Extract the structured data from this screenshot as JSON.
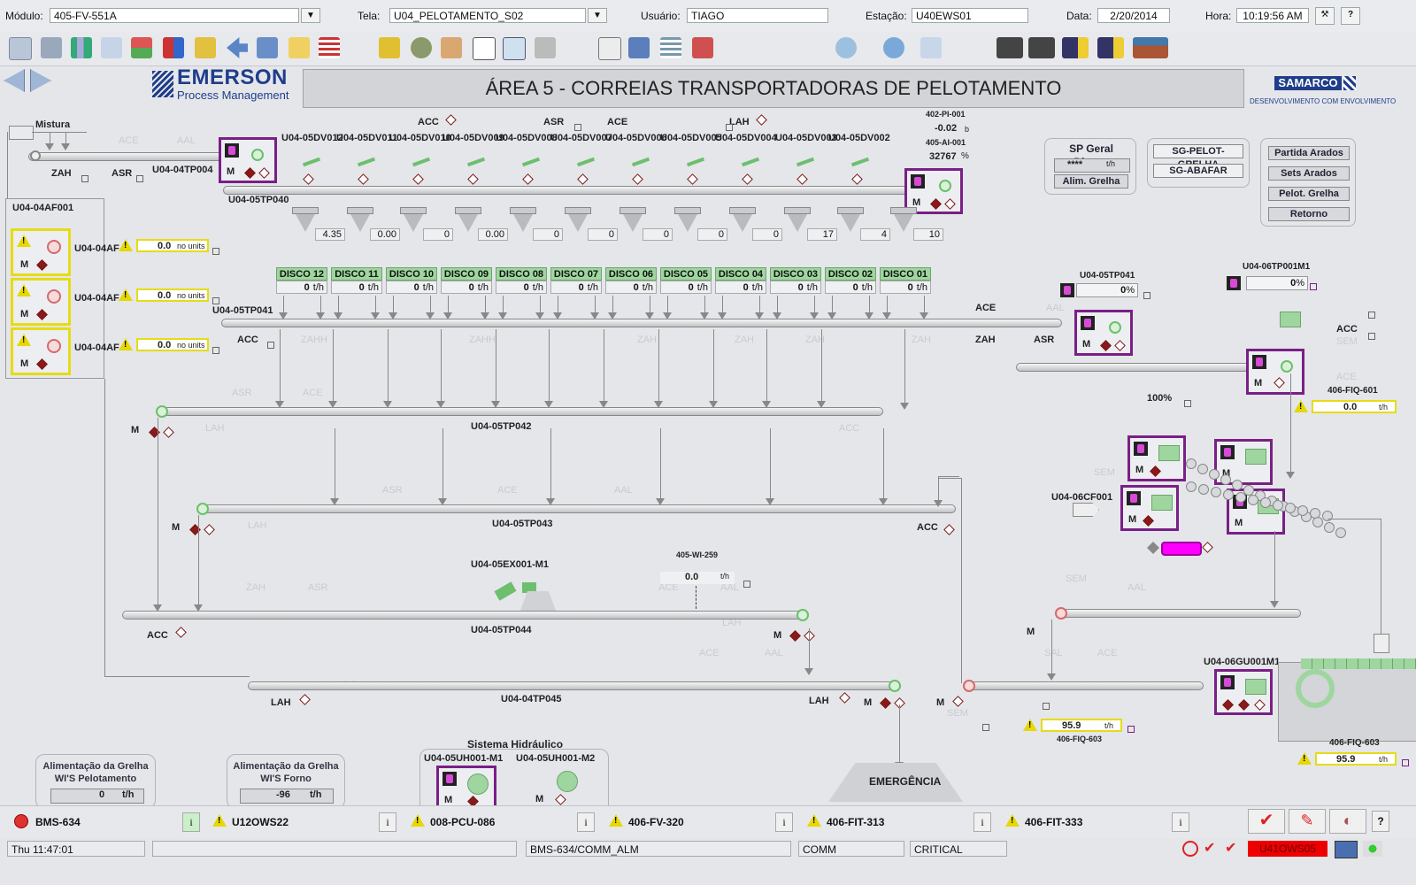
{
  "header": {
    "modulo_label": "Módulo:",
    "modulo_value": "405-FV-551A",
    "tela_label": "Tela:",
    "tela_value": "U04_PELOTAMENTO_S02",
    "usuario_label": "Usuário:",
    "usuario_value": "TIAGO",
    "estacao_label": "Estação:",
    "estacao_value": "U40EWS01",
    "data_label": "Data:",
    "data_value": "2/20/2014",
    "hora_label": "Hora:",
    "hora_value": "10:19:56 AM",
    "help_label": "?"
  },
  "brand": {
    "emerson": "EMERSON",
    "emerson_sub": "Process Management",
    "samarco": "SAMARCO",
    "samarco_sub": "DESENVOLVIMENTO COM ENVOLVIMENTO"
  },
  "title": "ÁREA 5 - CORREIAS TRANSPORTADORAS DE PELOTAMENTO",
  "top": {
    "mistura": "Mistura",
    "zah": "ZAH",
    "asr": "ASR",
    "tp004": "U04-04TP004",
    "acc": "ACC",
    "asr2": "ASR",
    "ace": "ACE",
    "lah": "LAH",
    "pi001_tag": "402-PI-001",
    "pi001_val": "-0.02",
    "pi001_unit": "b",
    "ai001_tag": "405-AI-001",
    "ai001_val": "32767",
    "ai001_unit": "%",
    "tp040": "U04-05TP040",
    "dv_tags": [
      "U04-05DV012",
      "U04-05DV011",
      "U04-05DV010",
      "U04-05DV009",
      "U04-05DV008",
      "U04-05DV007",
      "U04-05DV006",
      "U04-05DV005",
      "U04-05DV004",
      "U04-05DV003",
      "U04-05DV002"
    ]
  },
  "hoppers": [
    "4.35",
    "0.00",
    "0",
    "0.00",
    "0",
    "0",
    "0",
    "0",
    "0",
    "17",
    "4",
    "10"
  ],
  "discos": [
    {
      "name": "DISCO 12",
      "val": "0",
      "unit": "t/h"
    },
    {
      "name": "DISCO 11",
      "val": "0",
      "unit": "t/h"
    },
    {
      "name": "DISCO 10",
      "val": "0",
      "unit": "t/h"
    },
    {
      "name": "DISCO 09",
      "val": "0",
      "unit": "t/h"
    },
    {
      "name": "DISCO 08",
      "val": "0",
      "unit": "t/h"
    },
    {
      "name": "DISCO 07",
      "val": "0",
      "unit": "t/h"
    },
    {
      "name": "DISCO 06",
      "val": "0",
      "unit": "t/h"
    },
    {
      "name": "DISCO 05",
      "val": "0",
      "unit": "t/h"
    },
    {
      "name": "DISCO 04",
      "val": "0",
      "unit": "t/h"
    },
    {
      "name": "DISCO 03",
      "val": "0",
      "unit": "t/h"
    },
    {
      "name": "DISCO 02",
      "val": "0",
      "unit": "t/h"
    },
    {
      "name": "DISCO 01",
      "val": "0",
      "unit": "t/h"
    }
  ],
  "left": {
    "af001": "U04-04AF001",
    "af_short": "U04-04AF",
    "feeders": [
      {
        "val": "0.0",
        "unit": "no units"
      },
      {
        "val": "0.0",
        "unit": "no units"
      },
      {
        "val": "0.0",
        "unit": "no units"
      }
    ]
  },
  "belts": {
    "tp041": "U04-05TP041",
    "tp042": "U04-05TP042",
    "tp043": "U04-05TP043",
    "tp044": "U04-05TP044",
    "tp045": "U04-04TP045",
    "ex001": "U04-05EX001-M1",
    "wi259_tag": "405-WI-259",
    "wi259_val": "0.0",
    "wi259_unit": "t/h",
    "acc": "ACC",
    "lah": "LAH",
    "m": "M",
    "ace": "ACE",
    "zah": "ZAH",
    "asr": "ASR"
  },
  "right": {
    "sp_title": "SP Geral Discos",
    "sp_val": "****",
    "sp_unit": "t/h",
    "alim": "Alim. Grelha",
    "sg_pelot": "SG-PELOT-GRELHA",
    "sg_abafar": "SG-ABAFAR",
    "partida": "Partida Arados",
    "sets": "Sets Arados",
    "pelot": "Pelot. Grelha",
    "retorno": "Retorno",
    "tp041_tag": "U04-05TP041",
    "tp041_val": "0",
    "tp041_unit": "%",
    "tp001_tag": "U04-06TP001M1",
    "tp001_val": "0",
    "tp001_unit": "%",
    "pct100": "100%",
    "fiq601_tag": "406-FIQ-601",
    "fiq601_val": "0.0",
    "fiq601_unit": "t/h",
    "cf001": "U04-06CF001",
    "gu001": "U04-06GU001M1",
    "fiq603_tag": "406-FIQ-603",
    "fiq603_val": "95.9",
    "fiq603_unit": "t/h",
    "fiq603b_tag": "406-FIQ-603",
    "fiq603b_val": "95.9",
    "fiq603b_unit": "t/h",
    "acc": "ACC",
    "m": "M"
  },
  "bottom": {
    "alim_pel_title": "Alimentação da Grelha WI'S Pelotamento",
    "alim_pel_val": "0",
    "alim_pel_unit": "t/h",
    "alim_forno_title": "Alimentação da Grelha WI'S Forno",
    "alim_forno_val": "-96",
    "alim_forno_unit": "t/h",
    "hidr_title": "Sistema Hidráulico",
    "uh_m1": "U04-05UH001-M1",
    "uh_m2": "U04-05UH001-M2",
    "emergencia": "EMERGÊNCIA"
  },
  "alarms": [
    "BMS-634",
    "U12OWS22",
    "008-PCU-086",
    "406-FV-320",
    "406-FIT-313",
    "406-FIT-333"
  ],
  "alarm_info": "i",
  "footer": {
    "datetime": "Thu 11:47:01",
    "blank": "",
    "alm": "BMS-634/COMM_ALM",
    "comm": "COMM",
    "critical": "CRITICAL",
    "station": "U41OWS05"
  },
  "colors": {
    "accent": "#7a1f85",
    "warning": "#e6dc14",
    "running": "#6dbf6d",
    "stopped": "#d46a6a"
  }
}
